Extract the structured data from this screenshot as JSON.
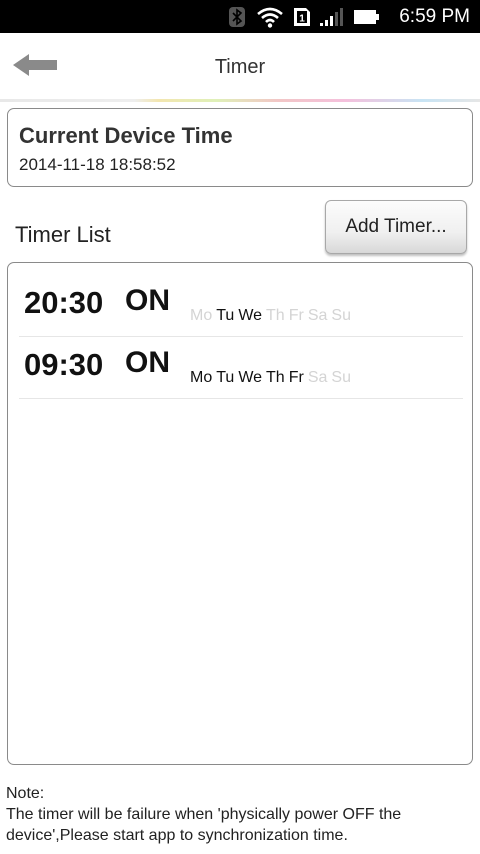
{
  "status_bar": {
    "time": "6:59 PM",
    "icons": [
      "bluetooth-icon",
      "wifi-icon",
      "sim-icon",
      "signal-icon",
      "battery-icon"
    ]
  },
  "app_bar": {
    "title": "Timer",
    "back_icon": "arrow-left-icon"
  },
  "device_time": {
    "title": "Current Device Time",
    "value": "2014-11-18 18:58:52"
  },
  "timer_list": {
    "label": "Timer List",
    "add_button_label": "Add Timer...",
    "timers": [
      {
        "time": "20:30",
        "state": "ON",
        "days": [
          {
            "label": "Mo",
            "active": false
          },
          {
            "label": "Tu",
            "active": true
          },
          {
            "label": "We",
            "active": true
          },
          {
            "label": "Th",
            "active": false
          },
          {
            "label": "Fr",
            "active": false
          },
          {
            "label": "Sa",
            "active": false
          },
          {
            "label": "Su",
            "active": false
          }
        ]
      },
      {
        "time": "09:30",
        "state": "ON",
        "days": [
          {
            "label": "Mo",
            "active": true
          },
          {
            "label": "Tu",
            "active": true
          },
          {
            "label": "We",
            "active": true
          },
          {
            "label": "Th",
            "active": true
          },
          {
            "label": "Fr",
            "active": true
          },
          {
            "label": "Sa",
            "active": false
          },
          {
            "label": "Su",
            "active": false
          }
        ]
      }
    ]
  },
  "note": {
    "label": "Note:",
    "text": "The timer will be failure when 'physically power OFF the device',Please start app to synchronization time."
  },
  "colors": {
    "status_bar_bg": "#000000",
    "active_day": "#111111",
    "inactive_day": "#d4d4d4",
    "border": "#8a8a8a"
  }
}
